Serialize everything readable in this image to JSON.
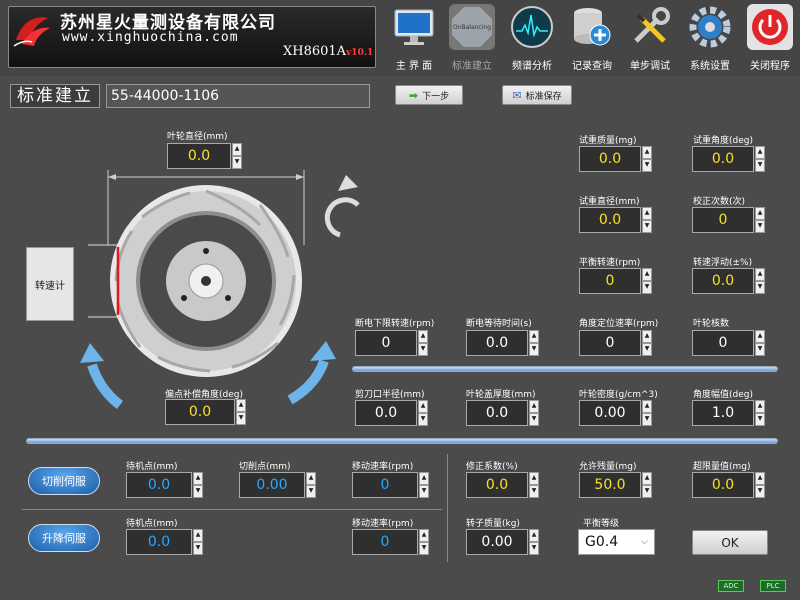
{
  "header": {
    "company": "苏州星火量测设备有限公司",
    "website": "www.xinghuochina.com",
    "model": "XH8601A",
    "version": "v10.1",
    "nav": [
      {
        "label": "主 界 面",
        "icon": "monitor-icon"
      },
      {
        "label": "标准建立",
        "icon": "standard-icon"
      },
      {
        "label": "频谱分析",
        "icon": "spectrum-icon"
      },
      {
        "label": "记录查询",
        "icon": "database-search-icon"
      },
      {
        "label": "单步调试",
        "icon": "tools-icon"
      },
      {
        "label": "系统设置",
        "icon": "gear-icon"
      },
      {
        "label": "关闭程序",
        "icon": "power-icon"
      }
    ],
    "nav_badge": "OnBalancing"
  },
  "toolbar": {
    "title": "标准建立",
    "standard_value": "55-44000-1106",
    "next_label": "下一步",
    "save_label": "标准保存"
  },
  "diagram": {
    "tach_label": "转速计",
    "diameter_label": "叶轮直径(mm)",
    "diameter_value": "0.0",
    "comp_angle_label": "偏点补偿角度(deg)",
    "comp_angle_value": "0.0"
  },
  "right_fields": {
    "trial_mass": {
      "label": "试重质量(mg)",
      "value": "0.0"
    },
    "trial_angle": {
      "label": "试重角度(deg)",
      "value": "0.0"
    },
    "trial_diameter": {
      "label": "试重直径(mm)",
      "value": "0.0"
    },
    "calib_count": {
      "label": "校正次数(次)",
      "value": "0"
    },
    "balance_speed": {
      "label": "平衡转速(rpm)",
      "value": "0"
    },
    "speed_float": {
      "label": "转速浮动(±%)",
      "value": "0.0"
    }
  },
  "mid_row1": {
    "low_speed": {
      "label": "断电下限转速(rpm)",
      "value": "0"
    },
    "wait_time": {
      "label": "断电等待时间(s)",
      "value": "0.0"
    },
    "locate_speed": {
      "label": "角度定位速率(rpm)",
      "value": "0"
    },
    "blade_count": {
      "label": "叶轮核数",
      "value": "0"
    }
  },
  "mid_row2": {
    "cut_radius": {
      "label": "剪刀口半径(mm)",
      "value": "0.0"
    },
    "cover_thick": {
      "label": "叶轮盖厚度(mm)",
      "value": "0.0"
    },
    "density": {
      "label": "叶轮密度(g/cm^3)",
      "value": "0.00"
    },
    "angle_amp": {
      "label": "角度幅值(deg)",
      "value": "1.0"
    }
  },
  "servo_cut": {
    "button": "切削伺服",
    "standby": {
      "label": "待机点(mm)",
      "value": "0.0"
    },
    "cutpoint": {
      "label": "切削点(mm)",
      "value": "0.00"
    },
    "speed": {
      "label": "移动速率(rpm)",
      "value": "0"
    }
  },
  "servo_lift": {
    "button": "升降伺服",
    "standby": {
      "label": "待机点(mm)",
      "value": "0.0"
    },
    "speed": {
      "label": "移动速率(rpm)",
      "value": "0"
    }
  },
  "correction": {
    "coef": {
      "label": "修正系数(%)",
      "value": "0.0"
    },
    "allowed": {
      "label": "允许残量(mg)",
      "value": "50.0"
    },
    "limit": {
      "label": "超限量值(mg)",
      "value": "0.0"
    },
    "rotor_mass": {
      "label": "转子质量(kg)",
      "value": "0.00"
    },
    "grade": {
      "label": "平衡等级",
      "value": "G0.4"
    },
    "ok_label": "OK"
  },
  "status": {
    "adc": "ADC",
    "plc": "PLC"
  },
  "colors": {
    "background": "#4b4b4b",
    "value_yellow": "#f5e12a",
    "value_blue": "#2aa7ff",
    "servo_button": "#2a78cc"
  }
}
